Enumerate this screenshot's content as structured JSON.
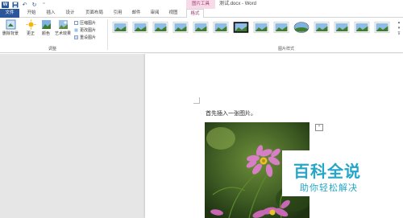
{
  "title_bar": {
    "document_title": "测试.docx - Word",
    "picture_tools_label": "图片工具",
    "qat_icons": [
      "word-logo-icon",
      "save-icon",
      "undo-icon",
      "redo-icon",
      "customize-icon"
    ]
  },
  "tabs": [
    {
      "label": "文件",
      "kind": "file"
    },
    {
      "label": "开始",
      "kind": "normal"
    },
    {
      "label": "插入",
      "kind": "normal"
    },
    {
      "label": "设计",
      "kind": "normal"
    },
    {
      "label": "页面布局",
      "kind": "normal"
    },
    {
      "label": "引用",
      "kind": "normal"
    },
    {
      "label": "邮件",
      "kind": "normal"
    },
    {
      "label": "审阅",
      "kind": "normal"
    },
    {
      "label": "视图",
      "kind": "normal"
    },
    {
      "label": "格式",
      "kind": "active"
    }
  ],
  "ribbon": {
    "adjust_group": {
      "label": "调整",
      "remove_bg": "删除背景",
      "corrections": "更正",
      "color": "颜色",
      "artistic": "艺术效果",
      "compress": "压缩图片",
      "change": "更改图片",
      "reset": "重设图片"
    },
    "styles_group": {
      "label": "图片样式",
      "style_count": 14
    }
  },
  "document": {
    "paragraph": "首先插入一张图片。",
    "layout_options_icon": "layout-options-icon"
  },
  "watermark": {
    "title": "百科全说",
    "subtitle": "助你轻松解决"
  },
  "colors": {
    "word_blue": "#2b579a",
    "picture_tools_pink": "#a33a74",
    "watermark_cyan": "#25a5c8"
  }
}
